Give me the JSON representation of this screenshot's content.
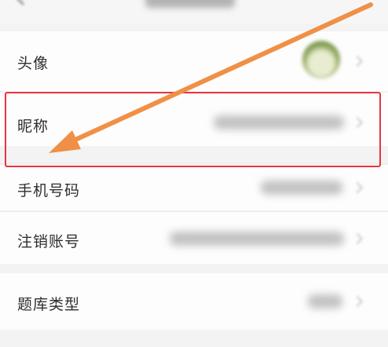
{
  "rows": {
    "avatar": {
      "label": "头像"
    },
    "nickname": {
      "label": "昵称"
    },
    "phone": {
      "label": "手机号码"
    },
    "cancel": {
      "label": "注销账号"
    },
    "bank": {
      "label": "题库类型"
    }
  },
  "colors": {
    "highlight": "#e8353c",
    "arrow": "#f09046"
  },
  "icons": [
    "back-icon",
    "chevron-right-icon"
  ]
}
